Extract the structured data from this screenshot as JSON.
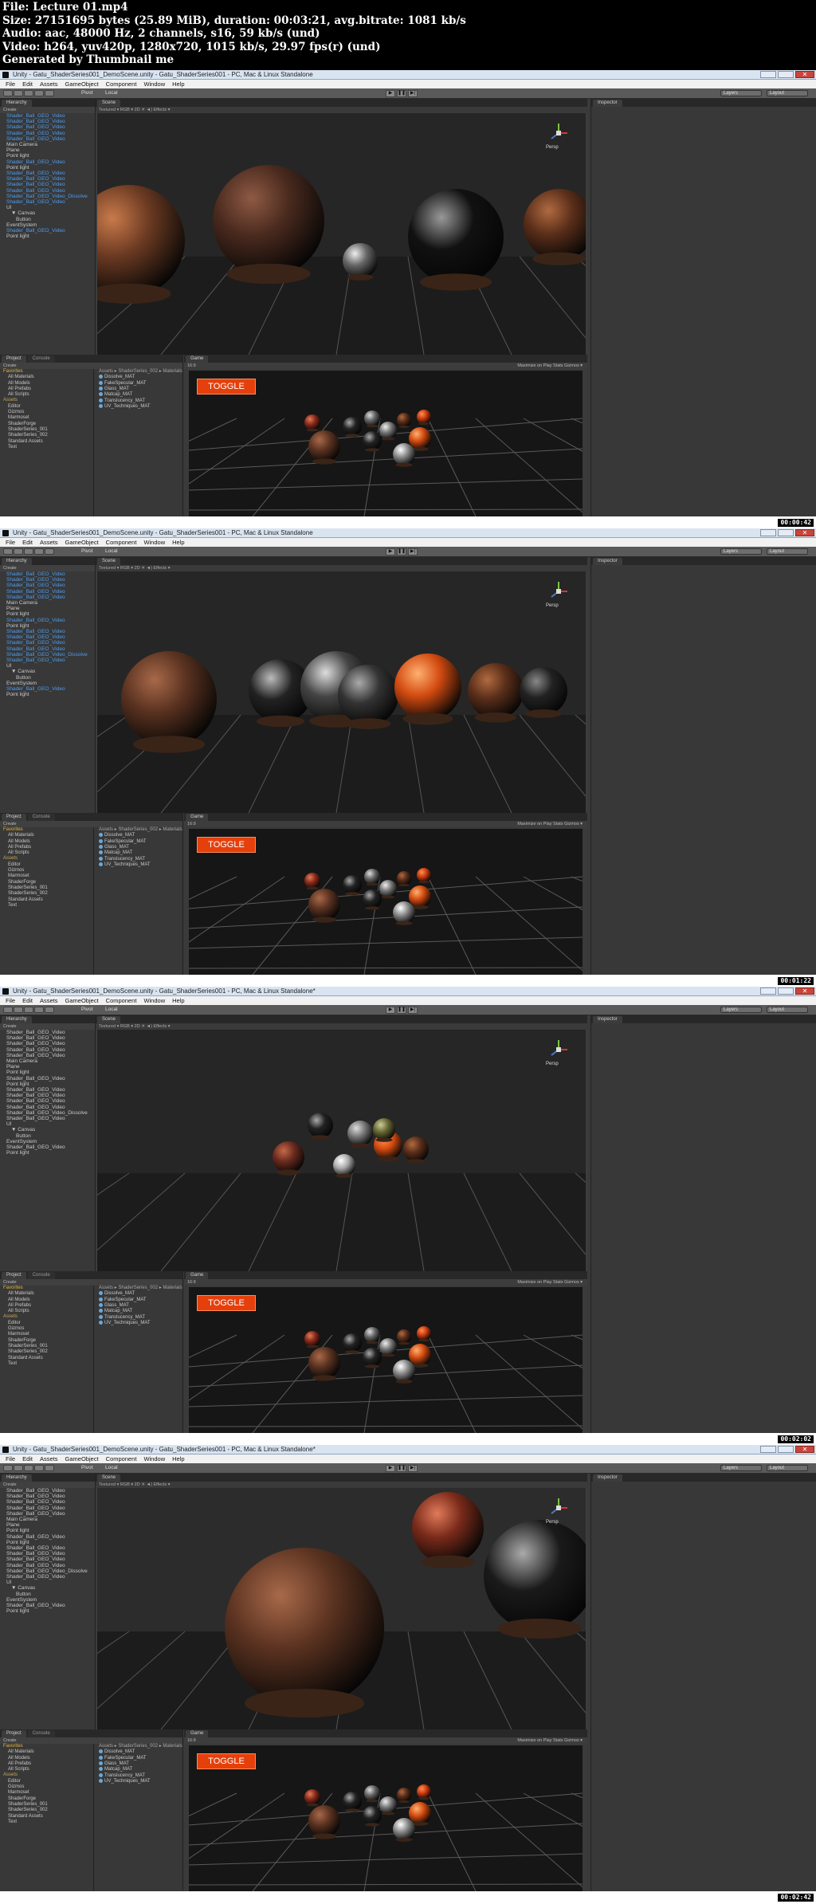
{
  "header": {
    "file": "File: Lecture 01.mp4",
    "size": "Size: 27151695 bytes (25.89 MiB), duration: 00:03:21, avg.bitrate: 1081 kb/s",
    "audio": "Audio: aac, 48000 Hz, 2 channels, s16, 59 kb/s (und)",
    "video": "Video: h264, yuv420p, 1280x720, 1015 kb/s, 29.97 fps(r) (und)",
    "generator": "Generated by Thumbnail me"
  },
  "frames": [
    {
      "title": "Unity - Gatu_ShaderSeries001_DemoScene.unity - Gatu_ShaderSeries001 - PC, Mac & Linux Standalone",
      "timestamp": "00:00:42"
    },
    {
      "title": "Unity - Gatu_ShaderSeries001_DemoScene.unity - Gatu_ShaderSeries001 - PC, Mac & Linux Standalone",
      "timestamp": "00:01:22"
    },
    {
      "title": "Unity - Gatu_ShaderSeries001_DemoScene.unity - Gatu_ShaderSeries001 - PC, Mac & Linux Standalone*",
      "timestamp": "00:02:02"
    },
    {
      "title": "Unity - Gatu_ShaderSeries001_DemoScene.unity - Gatu_ShaderSeries001 - PC, Mac & Linux Standalone*",
      "timestamp": "00:02:42"
    }
  ],
  "menu": [
    "File",
    "Edit",
    "Assets",
    "GameObject",
    "Component",
    "Window",
    "Help"
  ],
  "toolbar": {
    "pivot": "Pivot",
    "local": "Local",
    "layers": "Layers",
    "layout": "Layout"
  },
  "tabs": {
    "hierarchy": "Hierarchy",
    "scene": "Scene",
    "inspector": "Inspector",
    "project": "Project",
    "console": "Console",
    "game": "Game",
    "create": "Create"
  },
  "scene_toolbar": "Textured   ▾  RGB   ▾   2D   ☀   ◄)   Effects ▾",
  "gizmo_label": "Persp",
  "hierarchy": [
    {
      "label": "Shader_Ball_GEO_Video",
      "blue": true,
      "d": 0
    },
    {
      "label": "Shader_Ball_GEO_Video",
      "blue": true,
      "d": 0
    },
    {
      "label": "Shader_Ball_GEO_Video",
      "blue": true,
      "d": 0
    },
    {
      "label": "Shader_Ball_GEO_Video",
      "blue": true,
      "d": 0
    },
    {
      "label": "Shader_Ball_GEO_Video",
      "blue": true,
      "d": 0
    },
    {
      "label": "Main Camera",
      "blue": false,
      "d": 0
    },
    {
      "label": "Plane",
      "blue": false,
      "d": 0
    },
    {
      "label": "Point light",
      "blue": false,
      "d": 0
    },
    {
      "label": "Shader_Ball_GEO_Video",
      "blue": true,
      "d": 0
    },
    {
      "label": "Point light",
      "blue": false,
      "d": 0
    },
    {
      "label": "Shader_Ball_GEO_Video",
      "blue": true,
      "d": 0
    },
    {
      "label": "Shader_Ball_GEO_Video",
      "blue": true,
      "d": 0
    },
    {
      "label": "Shader_Ball_GEO_Video",
      "blue": true,
      "d": 0
    },
    {
      "label": "Shader_Ball_GEO_Video",
      "blue": true,
      "d": 0
    },
    {
      "label": "Shader_Ball_GEO_Video_Dissolve",
      "blue": true,
      "d": 0
    },
    {
      "label": "Shader_Ball_GEO_Video",
      "blue": true,
      "d": 0
    },
    {
      "label": "UI",
      "blue": false,
      "d": 0
    },
    {
      "label": "▼ Canvas",
      "blue": false,
      "d": 1
    },
    {
      "label": "Button",
      "blue": false,
      "d": 2
    },
    {
      "label": "EventSystem",
      "blue": false,
      "d": 0
    },
    {
      "label": "Shader_Ball_GEO_Video",
      "blue": true,
      "d": 0
    },
    {
      "label": "Point light",
      "blue": false,
      "d": 0
    }
  ],
  "project": {
    "breadcrumb": "Assets ▸ ShaderSeries_002 ▸ Materials",
    "left": [
      {
        "label": "Favorites",
        "cls": "star",
        "d": 0
      },
      {
        "label": "All Materials",
        "cls": "",
        "d": 1
      },
      {
        "label": "All Models",
        "cls": "",
        "d": 1
      },
      {
        "label": "All Prefabs",
        "cls": "",
        "d": 1
      },
      {
        "label": "All Scripts",
        "cls": "",
        "d": 1
      },
      {
        "label": "",
        "cls": "",
        "d": 0
      },
      {
        "label": "Assets",
        "cls": "fld",
        "d": 0
      },
      {
        "label": "Editor",
        "cls": "",
        "d": 1
      },
      {
        "label": "Gizmos",
        "cls": "",
        "d": 1
      },
      {
        "label": "Marmoset",
        "cls": "",
        "d": 1
      },
      {
        "label": "ShaderForge",
        "cls": "",
        "d": 1
      },
      {
        "label": "ShaderSeries_001",
        "cls": "",
        "d": 1
      },
      {
        "label": "ShaderSeries_002",
        "cls": "",
        "d": 1
      },
      {
        "label": "Standard Assets",
        "cls": "",
        "d": 1
      },
      {
        "label": "Text",
        "cls": "",
        "d": 1
      }
    ],
    "materials": [
      "Dissolve_MAT",
      "FakeSpecular_MAT",
      "Glass_MAT",
      "Matcap_MAT",
      "Translucency_MAT",
      "UV_Techniques_MAT"
    ]
  },
  "game": {
    "aspect": "16:9",
    "controls": "Maximize on Play   Stats   Gizmos ▾",
    "toggle_label": "TOGGLE"
  },
  "colors": {
    "toggle_button": "#e5400c",
    "selection": "#4d9cef"
  }
}
